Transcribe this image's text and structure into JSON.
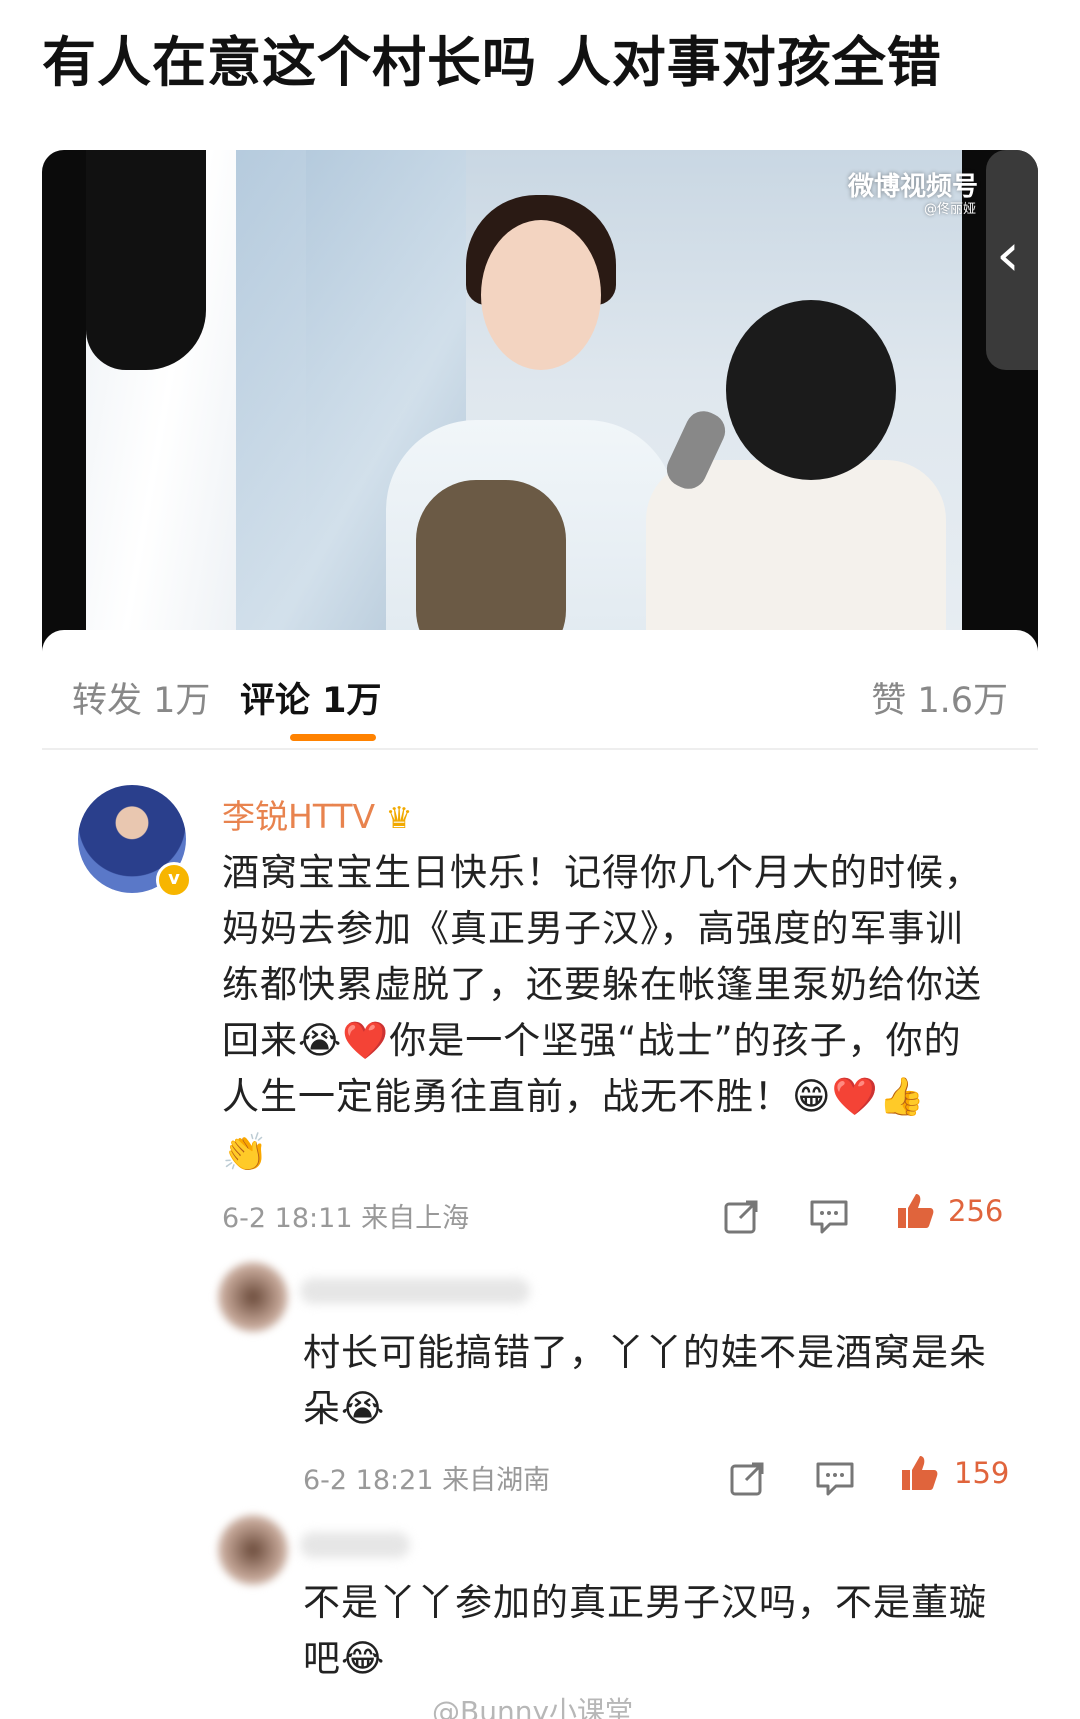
{
  "headline": "有人在意这个村长吗 人对事对孩全错",
  "video": {
    "watermark": "微博视频号",
    "watermark_sub": "@佟丽娅",
    "back_icon": "chevron-left-icon"
  },
  "tabs": {
    "repost": "转发 1万",
    "comments": "评论 1万",
    "likes": "赞 1.6万"
  },
  "comments": [
    {
      "name": "李锐HTTV",
      "badge_icon": "crown-icon",
      "lines": [
        "酒窝宝宝生日快乐！记得你几个月大的时候，",
        "妈妈去参加《真正男子汉》，高强度的军事训",
        "练都快累虚脱了，还要躲在帐篷里泵奶给你送",
        "回来😭❤️你是一个坚强“战士”的孩子，你的",
        "人生一定能勇往直前，战无不胜！😁❤️👍",
        "👏"
      ],
      "time": "6-2 18:11",
      "location": "来自上海",
      "likes": "256"
    },
    {
      "lines": [
        "村长可能搞错了，丫丫的娃不是酒窝是朵",
        "朵😭"
      ],
      "time": "6-2 18:21",
      "location": "来自湖南",
      "likes": "159"
    },
    {
      "lines": [
        "不是丫丫参加的真正男子汉吗，不是董璇",
        "吧😂"
      ]
    }
  ],
  "bottom_watermark": "@Bunny小课堂",
  "accent_color": "#ff8200",
  "name_color": "#e8834e",
  "like_color": "#e0643c"
}
